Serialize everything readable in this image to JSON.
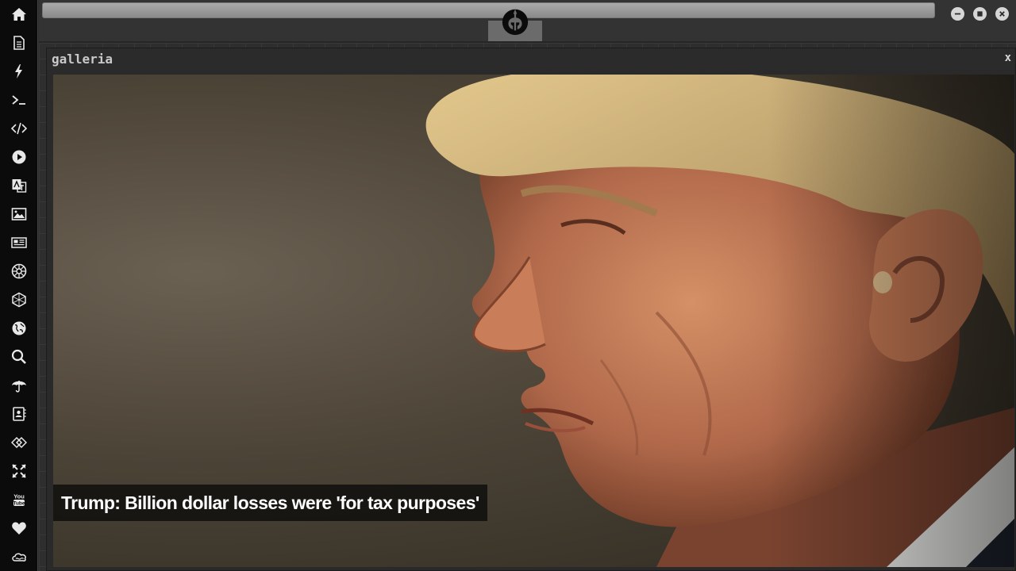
{
  "sidebar": {
    "items": [
      {
        "icon": "home-icon",
        "tooltip": "Home"
      },
      {
        "icon": "document-icon",
        "tooltip": "Documents"
      },
      {
        "icon": "lightning-icon",
        "tooltip": "Power"
      },
      {
        "icon": "terminal-icon",
        "tooltip": "Terminal"
      },
      {
        "icon": "code-icon",
        "tooltip": "Code"
      },
      {
        "icon": "play-icon",
        "tooltip": "Player"
      },
      {
        "icon": "translate-icon",
        "tooltip": "Translate"
      },
      {
        "icon": "image-icon",
        "tooltip": "Gallery"
      },
      {
        "icon": "newspaper-icon",
        "tooltip": "News"
      },
      {
        "icon": "empire-icon",
        "tooltip": "Empire"
      },
      {
        "icon": "hexagon-icon",
        "tooltip": "Network"
      },
      {
        "icon": "globe-icon",
        "tooltip": "Web"
      },
      {
        "icon": "search-icon",
        "tooltip": "Search"
      },
      {
        "icon": "umbrella-icon",
        "tooltip": "Weather"
      },
      {
        "icon": "contacts-icon",
        "tooltip": "Contacts"
      },
      {
        "icon": "link-icon",
        "tooltip": "Links"
      },
      {
        "icon": "expand-icon",
        "tooltip": "Fullscreen"
      },
      {
        "icon": "youtube-icon",
        "tooltip": "YouTube"
      },
      {
        "icon": "heart-icon",
        "tooltip": "Favorites"
      },
      {
        "icon": "cloud-icon",
        "tooltip": "Cloud"
      }
    ]
  },
  "topbar": {
    "emblem": "rebel-alliance-icon",
    "controls": [
      "minimize-icon",
      "maximize-icon",
      "close-icon"
    ]
  },
  "window": {
    "title": "galleria",
    "close_label": "x",
    "caption": "Trump: Billion dollar losses were 'for tax purposes'"
  },
  "colors": {
    "sidebar_bg": "#0b0b0b",
    "workspace_bg": "#2e2e2e",
    "icon": "#e8e8e8",
    "caption_bg": "#14120f"
  }
}
